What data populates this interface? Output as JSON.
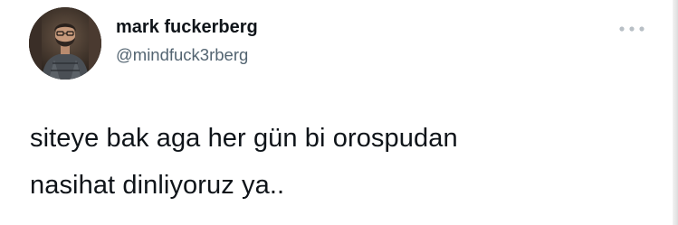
{
  "author": {
    "display_name": "mark fuckerberg",
    "handle": "@mindfuck3rberg",
    "avatar_icon": "profile-photo"
  },
  "menu": {
    "icon": "more-options-icon"
  },
  "tweet": {
    "lines": [
      "siteye bak aga her gün bi orospudan",
      "nasihat dinliyoruz ya.."
    ]
  },
  "colors": {
    "text_primary": "#0f1419",
    "text_secondary": "#536471",
    "icon": "#b8bfc5",
    "background": "#ffffff"
  }
}
